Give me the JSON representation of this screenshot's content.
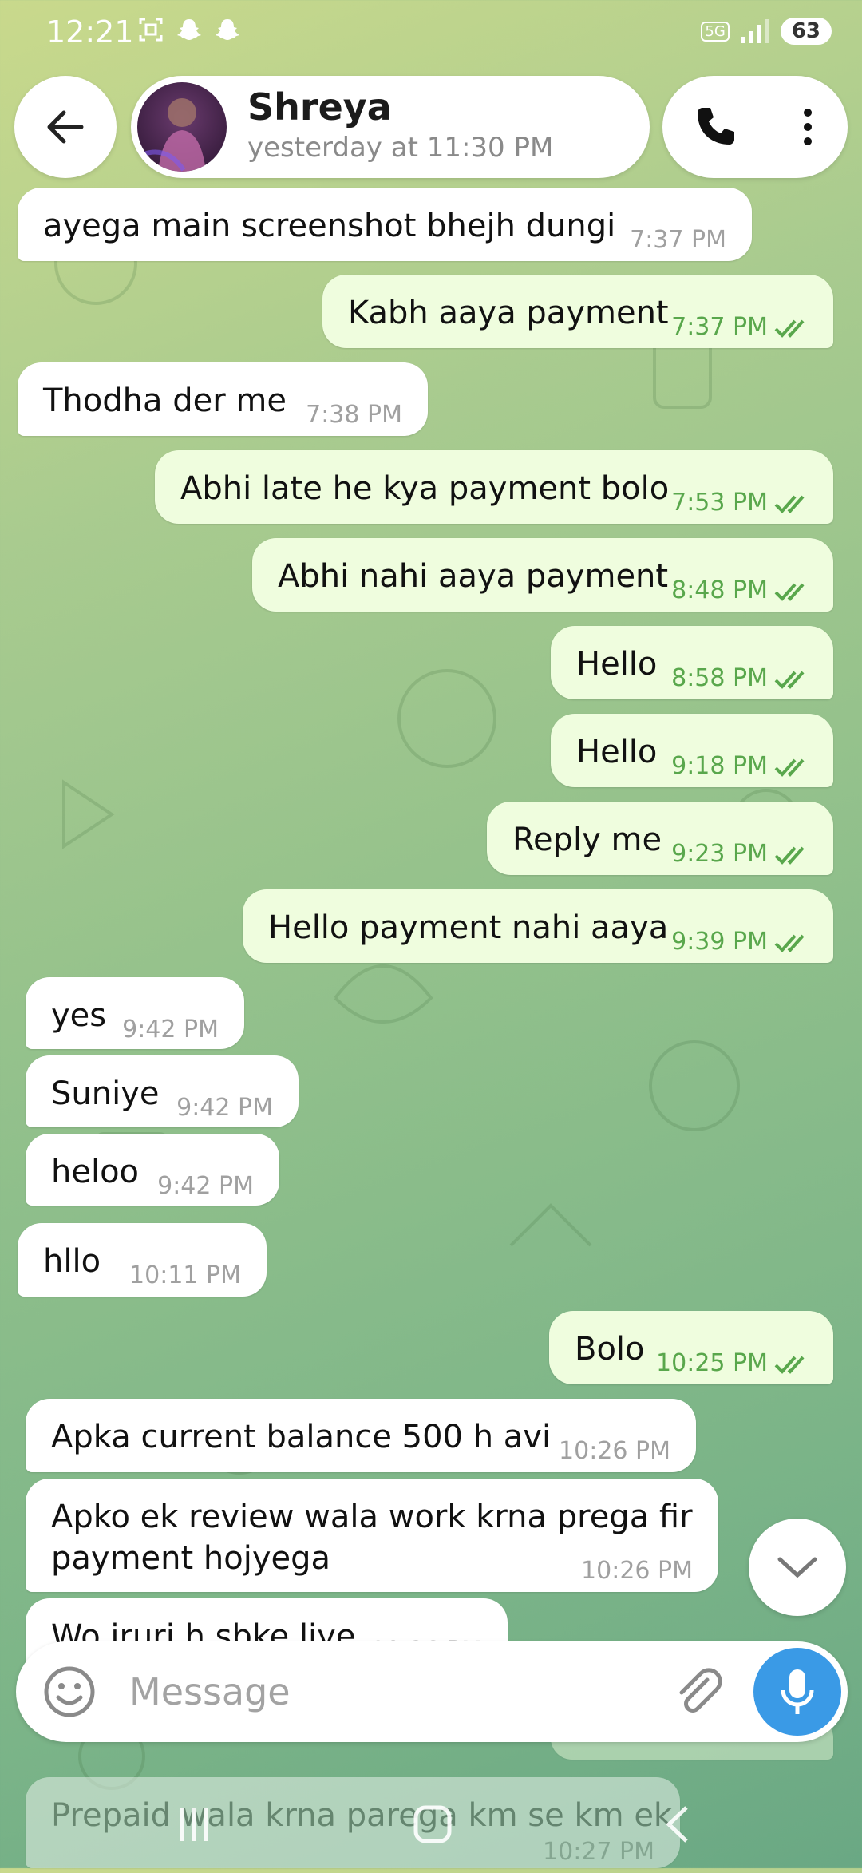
{
  "status_bar": {
    "time": "12:21",
    "network": "5G",
    "battery": "63"
  },
  "header": {
    "contact_name": "Shreya",
    "last_seen": "yesterday at 11:30 PM"
  },
  "messages": [
    {
      "dir": "in",
      "text": "ayega main screenshot bhejh dungi",
      "time": "7:37 PM"
    },
    {
      "dir": "out",
      "text": "Kabh aaya payment",
      "time": "7:37 PM"
    },
    {
      "dir": "in",
      "text": "Thodha der me",
      "time": "7:38 PM"
    },
    {
      "dir": "out",
      "text": "Abhi late he kya payment bolo",
      "time": "7:53 PM"
    },
    {
      "dir": "out",
      "text": "Abhi nahi aaya payment",
      "time": "8:48 PM"
    },
    {
      "dir": "out",
      "text": "Hello",
      "time": "8:58 PM"
    },
    {
      "dir": "out",
      "text": "Hello",
      "time": "9:18 PM"
    },
    {
      "dir": "out",
      "text": "Reply me",
      "time": "9:23 PM"
    },
    {
      "dir": "out",
      "text": "Hello payment nahi aaya",
      "time": "9:39 PM"
    },
    {
      "dir": "in",
      "text": "yes",
      "time": "9:42 PM"
    },
    {
      "dir": "in",
      "text": "Suniye",
      "time": "9:42 PM"
    },
    {
      "dir": "in",
      "text": "heloo",
      "time": "9:42 PM"
    },
    {
      "dir": "in",
      "text": "hllo",
      "time": "10:11 PM"
    },
    {
      "dir": "out",
      "text": "Bolo",
      "time": "10:25 PM"
    },
    {
      "dir": "in",
      "text": "Apka current balance 500 h avi",
      "time": "10:26 PM"
    },
    {
      "dir": "in",
      "text": "Apko ek review wala work krna prega fir",
      "text2": "payment hojyega",
      "time": "10:26 PM"
    },
    {
      "dir": "in",
      "text": "Wo jruri h sbke liye",
      "time": "10:26 PM"
    },
    {
      "dir": "in",
      "text": "Prepaid wala krna parega km se km ek",
      "time": "10:27 PM"
    }
  ],
  "composer": {
    "placeholder": "Message"
  },
  "icons": {
    "back": "arrow-left-icon",
    "phone": "phone-icon",
    "more": "more-vertical-icon",
    "emoji": "smiley-icon",
    "attach": "paperclip-icon",
    "mic": "microphone-icon",
    "scroll_down": "chevron-down-icon",
    "read": "double-check-icon"
  },
  "colors": {
    "outgoing_bubble": "#effdde",
    "incoming_bubble": "#ffffff",
    "accent": "#3a9ae6",
    "time_outgoing": "#59a74c"
  }
}
